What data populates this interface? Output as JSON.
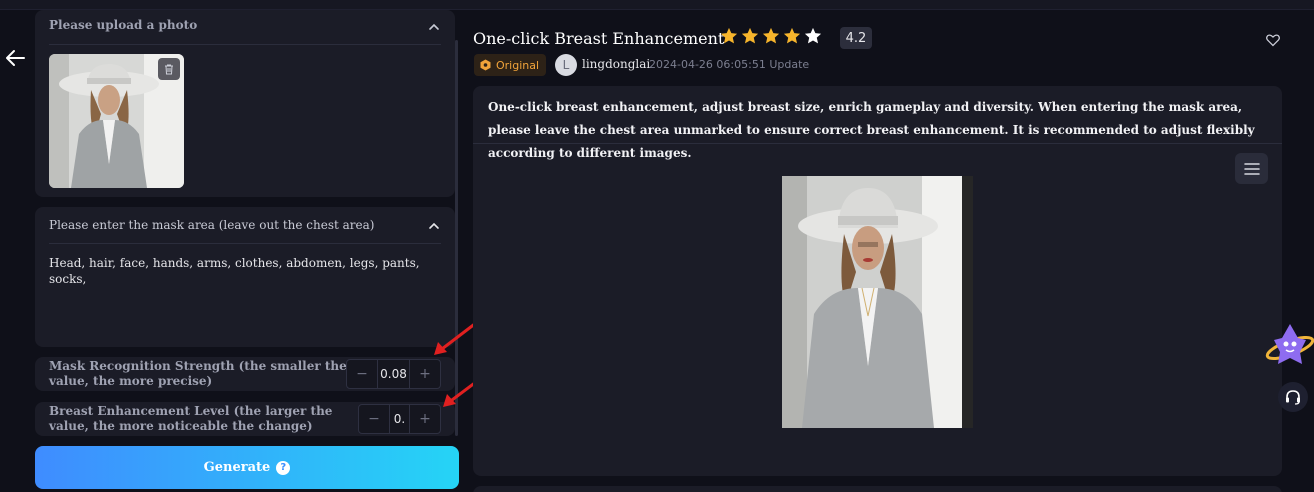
{
  "upload": {
    "header": "Please upload a photo"
  },
  "mask": {
    "header": "Please enter the mask area (leave out the chest area)",
    "value": "Head, hair, face, hands, arms, clothes, abdomen, legs, pants, socks,"
  },
  "params": {
    "strength": {
      "label": "Mask Recognition Strength (the smaller the value, the more precise)",
      "value": "0.08",
      "minus": "−",
      "plus": "+"
    },
    "breast": {
      "label": "Breast Enhancement Level (the larger the value, the more noticeable the change)",
      "value": "0.",
      "minus": "−",
      "plus": "+"
    }
  },
  "generate": {
    "label": "Generate",
    "help": "?"
  },
  "workflow": {
    "title": "One-click Breast Enhancement",
    "rating": "4.2",
    "rating_value": 4.2,
    "badge": "Original",
    "author_initial": "L",
    "author": "lingdonglai",
    "updated": "2024-04-26 06:05:51 Update",
    "description": "One-click breast enhancement, adjust breast size, enrich gameplay and diversity. When entering the mask area, please leave the chest area unmarked to ensure correct breast enhancement. It is recommended to adjust flexibly according to different images."
  },
  "colors": {
    "accent_start": "#3f8cff",
    "accent_end": "#25d4f6",
    "star": "#f7b52c",
    "badge": "#f0a33a",
    "annotation_arrow": "#e02020"
  },
  "icons": {
    "back": "arrow-left-icon",
    "collapse": "chevron-up-icon",
    "trash": "trash-icon",
    "star": "star-icon",
    "favorite": "heart-icon",
    "menu": "menu-icon",
    "support": "headset-icon",
    "mascot": "assistant-mascot-icon",
    "help": "question-circle-icon"
  }
}
